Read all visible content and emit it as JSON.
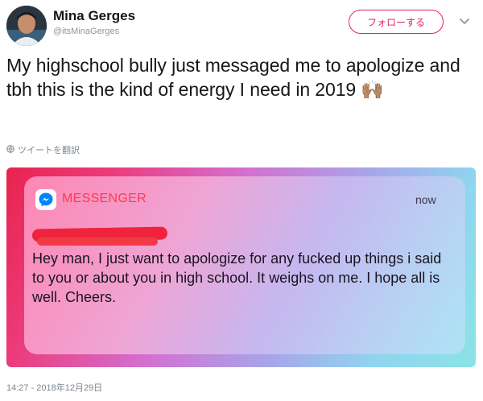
{
  "author": {
    "name": "Mina Gerges",
    "handle": "@itsMinaGerges",
    "avatar_icon": "profile-photo"
  },
  "follow_button": {
    "label": "フォローする"
  },
  "menu_icon": "chevron-down-icon",
  "tweet": {
    "text": "My highschool bully just messaged me to apologize and tbh this is the kind of energy I need in 2019 🙌🏽",
    "translate_label": "ツイートを翻訳",
    "timestamp": "14:27 - 2018年12月29日"
  },
  "notification": {
    "app_name": "MESSENGER",
    "time": "now",
    "message": "Hey man, I just want to apologize for any fucked up things i said to you or about you in high school. It weighs on me. I hope all is well. Cheers."
  },
  "colors": {
    "follow_accent": "#e0245e",
    "app_name": "#ff3b4e",
    "redaction": "#f0233d",
    "messenger_blue": "#0084ff"
  }
}
